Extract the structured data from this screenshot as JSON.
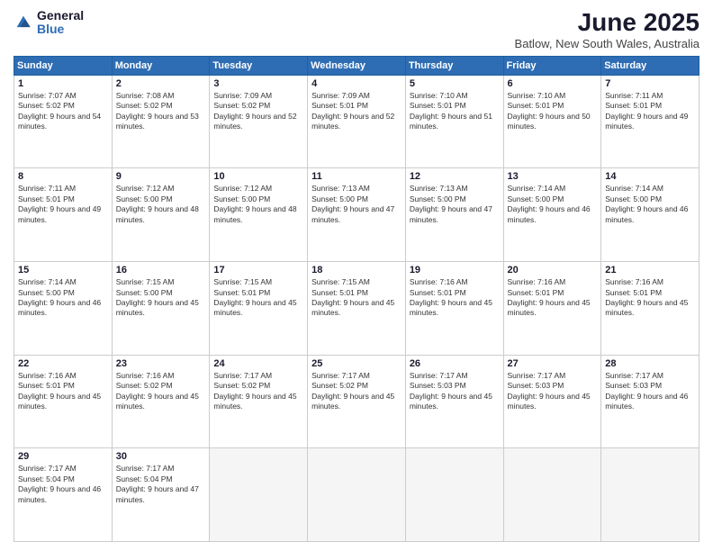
{
  "logo": {
    "general": "General",
    "blue": "Blue"
  },
  "title": "June 2025",
  "location": "Batlow, New South Wales, Australia",
  "headers": [
    "Sunday",
    "Monday",
    "Tuesday",
    "Wednesday",
    "Thursday",
    "Friday",
    "Saturday"
  ],
  "weeks": [
    [
      {
        "day": "1",
        "sunrise": "Sunrise: 7:07 AM",
        "sunset": "Sunset: 5:02 PM",
        "daylight": "Daylight: 9 hours and 54 minutes."
      },
      {
        "day": "2",
        "sunrise": "Sunrise: 7:08 AM",
        "sunset": "Sunset: 5:02 PM",
        "daylight": "Daylight: 9 hours and 53 minutes."
      },
      {
        "day": "3",
        "sunrise": "Sunrise: 7:09 AM",
        "sunset": "Sunset: 5:02 PM",
        "daylight": "Daylight: 9 hours and 52 minutes."
      },
      {
        "day": "4",
        "sunrise": "Sunrise: 7:09 AM",
        "sunset": "Sunset: 5:01 PM",
        "daylight": "Daylight: 9 hours and 52 minutes."
      },
      {
        "day": "5",
        "sunrise": "Sunrise: 7:10 AM",
        "sunset": "Sunset: 5:01 PM",
        "daylight": "Daylight: 9 hours and 51 minutes."
      },
      {
        "day": "6",
        "sunrise": "Sunrise: 7:10 AM",
        "sunset": "Sunset: 5:01 PM",
        "daylight": "Daylight: 9 hours and 50 minutes."
      },
      {
        "day": "7",
        "sunrise": "Sunrise: 7:11 AM",
        "sunset": "Sunset: 5:01 PM",
        "daylight": "Daylight: 9 hours and 49 minutes."
      }
    ],
    [
      {
        "day": "8",
        "sunrise": "Sunrise: 7:11 AM",
        "sunset": "Sunset: 5:01 PM",
        "daylight": "Daylight: 9 hours and 49 minutes."
      },
      {
        "day": "9",
        "sunrise": "Sunrise: 7:12 AM",
        "sunset": "Sunset: 5:00 PM",
        "daylight": "Daylight: 9 hours and 48 minutes."
      },
      {
        "day": "10",
        "sunrise": "Sunrise: 7:12 AM",
        "sunset": "Sunset: 5:00 PM",
        "daylight": "Daylight: 9 hours and 48 minutes."
      },
      {
        "day": "11",
        "sunrise": "Sunrise: 7:13 AM",
        "sunset": "Sunset: 5:00 PM",
        "daylight": "Daylight: 9 hours and 47 minutes."
      },
      {
        "day": "12",
        "sunrise": "Sunrise: 7:13 AM",
        "sunset": "Sunset: 5:00 PM",
        "daylight": "Daylight: 9 hours and 47 minutes."
      },
      {
        "day": "13",
        "sunrise": "Sunrise: 7:14 AM",
        "sunset": "Sunset: 5:00 PM",
        "daylight": "Daylight: 9 hours and 46 minutes."
      },
      {
        "day": "14",
        "sunrise": "Sunrise: 7:14 AM",
        "sunset": "Sunset: 5:00 PM",
        "daylight": "Daylight: 9 hours and 46 minutes."
      }
    ],
    [
      {
        "day": "15",
        "sunrise": "Sunrise: 7:14 AM",
        "sunset": "Sunset: 5:00 PM",
        "daylight": "Daylight: 9 hours and 46 minutes."
      },
      {
        "day": "16",
        "sunrise": "Sunrise: 7:15 AM",
        "sunset": "Sunset: 5:00 PM",
        "daylight": "Daylight: 9 hours and 45 minutes."
      },
      {
        "day": "17",
        "sunrise": "Sunrise: 7:15 AM",
        "sunset": "Sunset: 5:01 PM",
        "daylight": "Daylight: 9 hours and 45 minutes."
      },
      {
        "day": "18",
        "sunrise": "Sunrise: 7:15 AM",
        "sunset": "Sunset: 5:01 PM",
        "daylight": "Daylight: 9 hours and 45 minutes."
      },
      {
        "day": "19",
        "sunrise": "Sunrise: 7:16 AM",
        "sunset": "Sunset: 5:01 PM",
        "daylight": "Daylight: 9 hours and 45 minutes."
      },
      {
        "day": "20",
        "sunrise": "Sunrise: 7:16 AM",
        "sunset": "Sunset: 5:01 PM",
        "daylight": "Daylight: 9 hours and 45 minutes."
      },
      {
        "day": "21",
        "sunrise": "Sunrise: 7:16 AM",
        "sunset": "Sunset: 5:01 PM",
        "daylight": "Daylight: 9 hours and 45 minutes."
      }
    ],
    [
      {
        "day": "22",
        "sunrise": "Sunrise: 7:16 AM",
        "sunset": "Sunset: 5:01 PM",
        "daylight": "Daylight: 9 hours and 45 minutes."
      },
      {
        "day": "23",
        "sunrise": "Sunrise: 7:16 AM",
        "sunset": "Sunset: 5:02 PM",
        "daylight": "Daylight: 9 hours and 45 minutes."
      },
      {
        "day": "24",
        "sunrise": "Sunrise: 7:17 AM",
        "sunset": "Sunset: 5:02 PM",
        "daylight": "Daylight: 9 hours and 45 minutes."
      },
      {
        "day": "25",
        "sunrise": "Sunrise: 7:17 AM",
        "sunset": "Sunset: 5:02 PM",
        "daylight": "Daylight: 9 hours and 45 minutes."
      },
      {
        "day": "26",
        "sunrise": "Sunrise: 7:17 AM",
        "sunset": "Sunset: 5:03 PM",
        "daylight": "Daylight: 9 hours and 45 minutes."
      },
      {
        "day": "27",
        "sunrise": "Sunrise: 7:17 AM",
        "sunset": "Sunset: 5:03 PM",
        "daylight": "Daylight: 9 hours and 45 minutes."
      },
      {
        "day": "28",
        "sunrise": "Sunrise: 7:17 AM",
        "sunset": "Sunset: 5:03 PM",
        "daylight": "Daylight: 9 hours and 46 minutes."
      }
    ],
    [
      {
        "day": "29",
        "sunrise": "Sunrise: 7:17 AM",
        "sunset": "Sunset: 5:04 PM",
        "daylight": "Daylight: 9 hours and 46 minutes."
      },
      {
        "day": "30",
        "sunrise": "Sunrise: 7:17 AM",
        "sunset": "Sunset: 5:04 PM",
        "daylight": "Daylight: 9 hours and 47 minutes."
      },
      null,
      null,
      null,
      null,
      null
    ]
  ]
}
